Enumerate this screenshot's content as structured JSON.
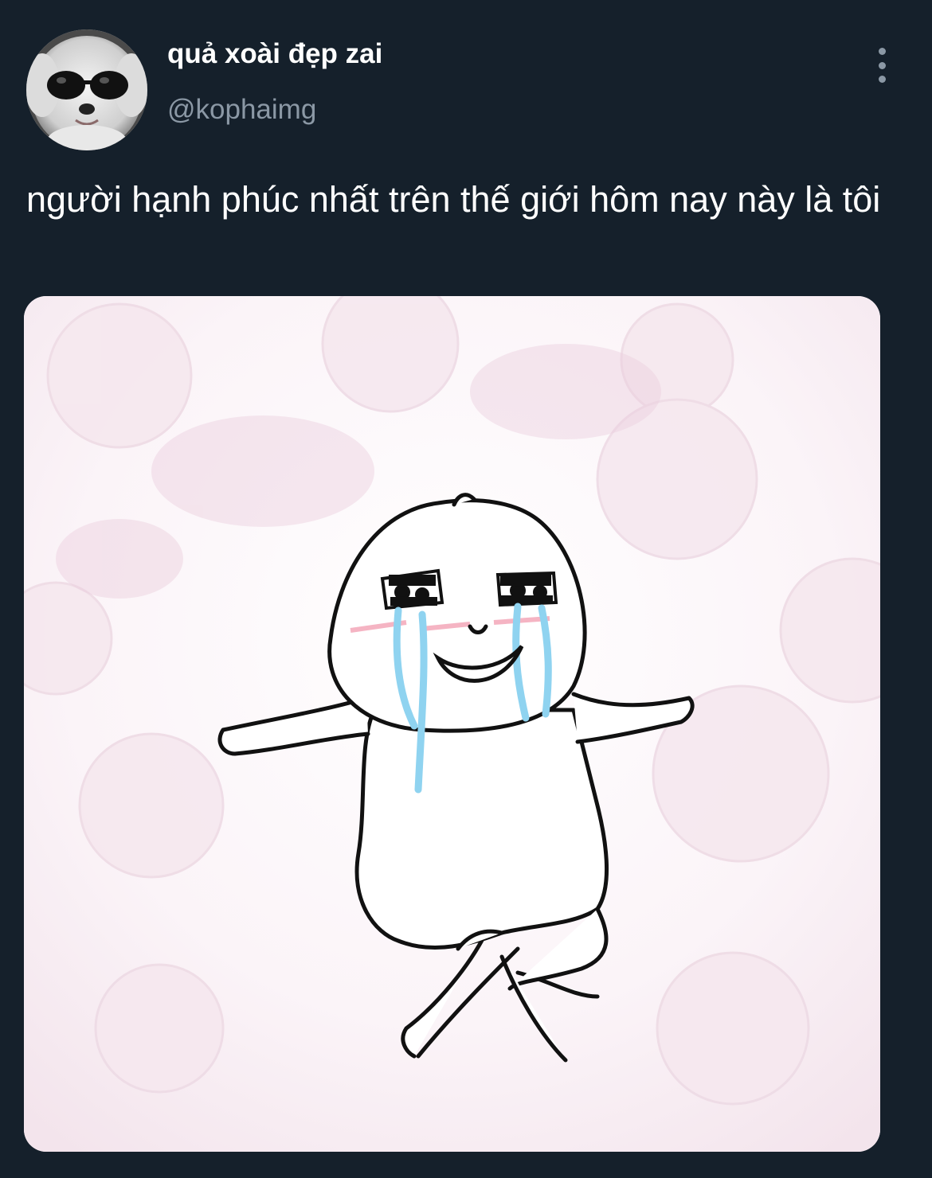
{
  "tweet": {
    "display_name": "quả xoài đẹp zai",
    "handle": "@kophaimg",
    "text": "người hạnh phúc nhất trên thế giới hôm nay này là tôi"
  },
  "icons": {
    "avatar": "dog-with-sunglasses-avatar",
    "more": "more-vertical-icon"
  },
  "colors": {
    "background": "#15202b",
    "secondary_text": "#8b98a5",
    "tear": "#8fd3f0",
    "blush": "#f29bb0"
  }
}
